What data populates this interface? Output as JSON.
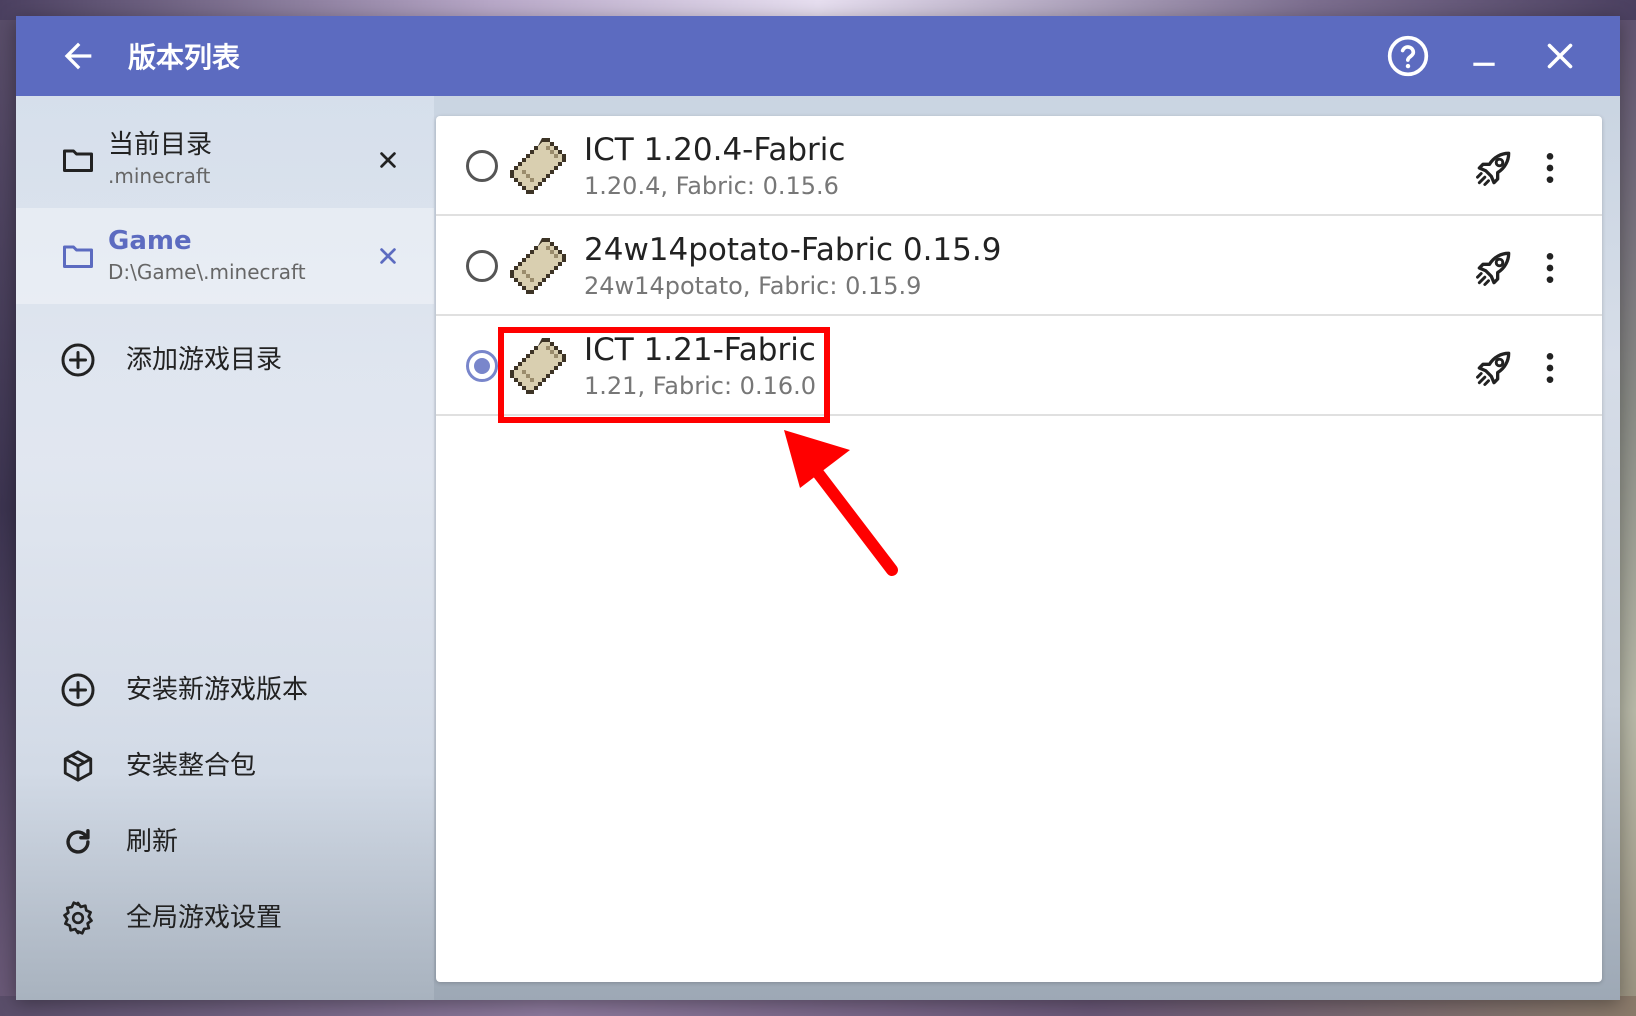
{
  "window": {
    "title": "版本列表"
  },
  "sidebar": {
    "directories": [
      {
        "name": "当前目录",
        "path": ".minecraft",
        "selected": false
      },
      {
        "name": "Game",
        "path": "D:\\Game\\.minecraft",
        "selected": true
      }
    ],
    "add_dir_label": "添加游戏目录",
    "actions": [
      {
        "label": "安装新游戏版本",
        "icon": "add-circle-icon"
      },
      {
        "label": "安装整合包",
        "icon": "package-icon"
      },
      {
        "label": "刷新",
        "icon": "refresh-icon"
      },
      {
        "label": "全局游戏设置",
        "icon": "gear-icon"
      }
    ]
  },
  "versions": [
    {
      "name": "ICT 1.20.4-Fabric",
      "detail": "1.20.4, Fabric: 0.15.6",
      "selected": false
    },
    {
      "name": "24w14potato-Fabric 0.15.9",
      "detail": "24w14potato, Fabric: 0.15.9",
      "selected": false
    },
    {
      "name": "ICT 1.21-Fabric",
      "detail": "1.21, Fabric: 0.16.0",
      "selected": true
    }
  ],
  "colors": {
    "accent": "#5c6bc0",
    "radio_selected": "#7986cb",
    "annotation": "#ff0000"
  }
}
